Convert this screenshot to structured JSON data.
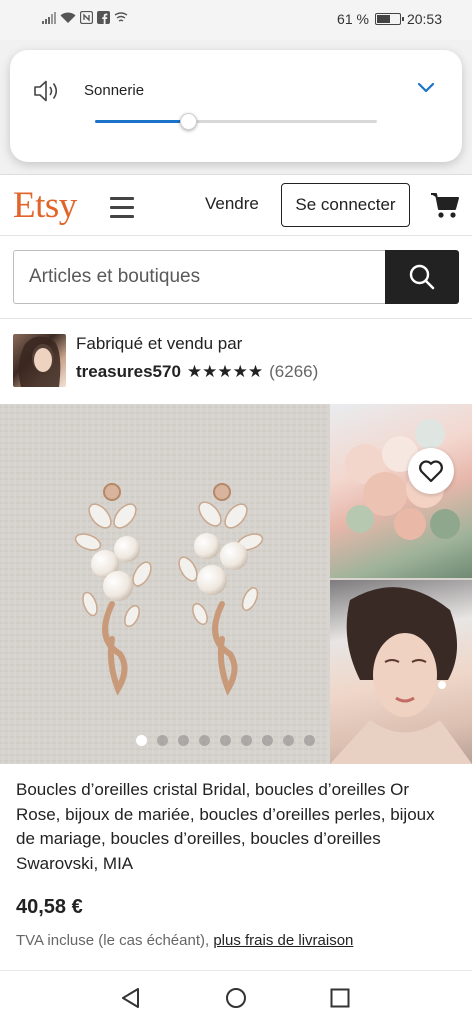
{
  "status_bar": {
    "battery_text": "61 %",
    "battery_level": 0.61,
    "time": "20:53",
    "icons": [
      "signal-icon",
      "wifi-icon",
      "nfc-icon",
      "facebook-icon",
      "screen-share-icon"
    ]
  },
  "volume_panel": {
    "label": "Sonnerie",
    "level": 0.33,
    "accent_color": "#1a73c9"
  },
  "header": {
    "logo": "Etsy",
    "logo_color": "#e0652b",
    "sell_label": "Vendre",
    "signin_label": "Se connecter"
  },
  "search": {
    "placeholder": "Articles et boutiques"
  },
  "shop": {
    "made_by": "Fabriqué et vendu par",
    "name": "treasures570",
    "stars": "★★★★★",
    "rating": 5,
    "reviews": "(6266)"
  },
  "gallery": {
    "image_count": 9,
    "active_index": 0
  },
  "product": {
    "title": "Boucles d’oreilles cristal Bridal, boucles d’oreilles Or Rose, bijoux de mariée, boucles d’oreilles perles, bijoux de mariage, boucles d’oreilles, boucles d’oreilles Swarovski, MIA",
    "price": "40,58 €",
    "tax_note": "TVA incluse (le cas échéant),",
    "shipping_link": "plus frais de livraison"
  }
}
